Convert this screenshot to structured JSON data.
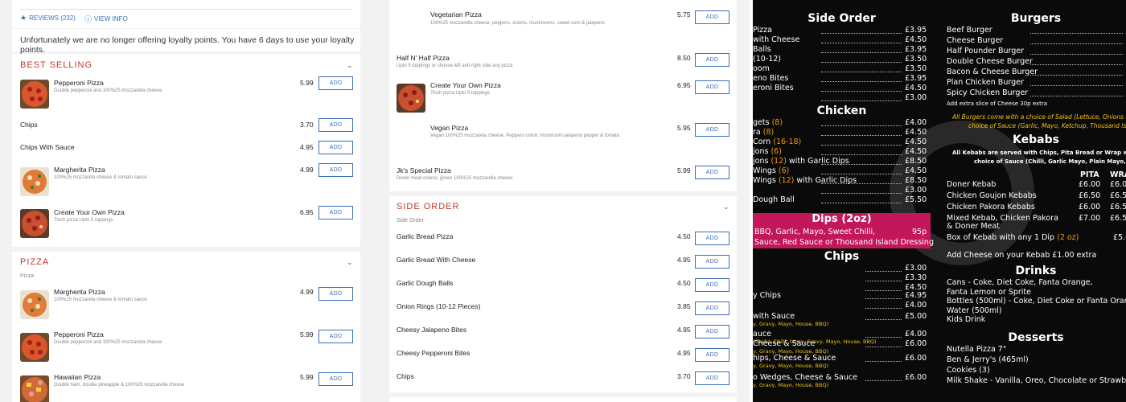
{
  "header": {
    "reviews": "REVIEWS (232)",
    "view_info": "VIEW INFO",
    "loyalty_notice": "Unfortunately we are no longer offering loyalty points. You have 6 days to use your loyalty points."
  },
  "add_label": "ADD",
  "best_selling": {
    "title": "BEST SELLING",
    "items": [
      {
        "name": "Pepperoni Pizza",
        "desc": "Double pepperoni and 100%25 mozzarella cheese",
        "price": "5.99"
      },
      {
        "name": "Chips",
        "desc": "",
        "price": "3.70"
      },
      {
        "name": "Chips With Sauce",
        "desc": "",
        "price": "4.95"
      },
      {
        "name": "Margherita Pizza",
        "desc": "100%25 mozzarela cheese & tomato sauce",
        "price": "4.99"
      },
      {
        "name": "Create Your Own Pizza",
        "desc": "7inch pizza Upto 5 toppings",
        "price": "6.95"
      }
    ]
  },
  "pizza": {
    "title": "PIZZA",
    "subtitle": "Pizza",
    "items": [
      {
        "name": "Margherita Pizza",
        "desc": "100%25 mozzarela cheese & tomato sauce",
        "price": "4.99"
      },
      {
        "name": "Pepperoni Pizza",
        "desc": "Double pepperoni and 100%25 mozzarella cheese",
        "price": "5.99"
      },
      {
        "name": "Hawaiian Pizza",
        "desc": "Double ham, double pineapple & 100%25 mozzarella cheese",
        "price": "5.99"
      }
    ]
  },
  "pizza_continued": {
    "items": [
      {
        "name": "Vegetarian Pizza",
        "desc": "100%25 mozzarella cheese, peppers, onions, mushrooms, sweet corn & jalapeno",
        "price": "5.75"
      },
      {
        "name": "Half N' Half Pizza",
        "desc": "Upto 5 toppings or choose left and right side any pizza",
        "price": "8.50"
      },
      {
        "name": "Create Your Own Pizza",
        "desc": "7inch pizza Upto 5 toppings",
        "price": "6.95"
      },
      {
        "name": "Vegan Pizza",
        "desc": "Vegan 100%25 mozzarela cheese. Peppers onion, mushroom jalapeno pepper & tomato",
        "price": "5.95"
      },
      {
        "name": "Jk's Special Pizza",
        "desc": "Doner meat onions, green 100%25 mozzarella cheese",
        "price": "5.99"
      }
    ]
  },
  "side_order": {
    "title": "SIDE ORDER",
    "subtitle": "Side Order",
    "items": [
      {
        "name": "Garlic Bread Pizza",
        "price": "4.50"
      },
      {
        "name": "Garlic Bread With Cheese",
        "price": "4.95"
      },
      {
        "name": "Garlic Dough Balls",
        "price": "4.50"
      },
      {
        "name": "Onion Rings (10-12 Pieces)",
        "price": "3.85"
      },
      {
        "name": "Cheesy Jalapeno Bites",
        "price": "4.95"
      },
      {
        "name": "Cheesy Pepperoni Bites",
        "price": "4.95"
      },
      {
        "name": "Chips",
        "price": "3.70"
      }
    ]
  },
  "menu_board": {
    "side_order_title": "Side Order",
    "side_items": [
      {
        "name": "Pizza",
        "price": "£3.95"
      },
      {
        "name": "with Cheese",
        "price": "£4.50"
      },
      {
        "name": "Balls",
        "price": "£3.95"
      },
      {
        "name": "(10-12)",
        "price": "£3.50"
      },
      {
        "name": "oom",
        "price": "£3.50"
      },
      {
        "name": "eno Bites",
        "price": "£3.95"
      },
      {
        "name": "eroni Bites",
        "price": "£4.50"
      },
      {
        "name": "",
        "price": "£3.00"
      }
    ],
    "chicken_title": "Chicken",
    "chicken_items": [
      {
        "name": "gets",
        "qty": "(8)",
        "rest": "",
        "price": "£4.00"
      },
      {
        "name": "ra",
        "qty": "(8)",
        "rest": "",
        "price": "£4.50"
      },
      {
        "name": "Corn",
        "qty": "(16-18)",
        "rest": "",
        "price": "£4.50"
      },
      {
        "name": "jons",
        "qty": "(6)",
        "rest": "",
        "price": "£4.50"
      },
      {
        "name": "jons",
        "qty": "(12)",
        "rest": "with Garlic Dips",
        "price": "£8.50"
      },
      {
        "name": "Wings",
        "qty": "(6)",
        "rest": "",
        "price": "£4.50"
      },
      {
        "name": "Wings",
        "qty": "(12)",
        "rest": "with Garlic Dips",
        "price": "£8.50"
      },
      {
        "name": "",
        "qty": "",
        "rest": "",
        "price": "£3.00"
      },
      {
        "name": "Dough Ball",
        "qty": "",
        "rest": "",
        "price": "£5.50"
      }
    ],
    "dips_title": "Dips (2oz)",
    "dips_line1": "BBQ, Garlic, Mayo, Sweet Chilli,",
    "dips_line2": "Sauce, Red Sauce or Thousand Island Dressing",
    "dips_price": "95p",
    "chips_title": "Chips",
    "chips_items": [
      {
        "name": "",
        "sub": "",
        "price": "£3.00"
      },
      {
        "name": "",
        "sub": "",
        "price": "£3.30"
      },
      {
        "name": "",
        "sub": "",
        "price": "£4.50"
      },
      {
        "name": "y Chips",
        "sub": "",
        "price": "£4.95"
      },
      {
        "name": "",
        "sub": "",
        "price": "£4.00"
      },
      {
        "name": "with Sauce",
        "sub": "y, Gravy, Mayo, House, BBQ)",
        "price": "£5.00"
      },
      {
        "name": "auce",
        "sub": "(Garlic, Chilli, Curry, Gravy, Mayo, House, BBQ)",
        "price": "£4.00"
      },
      {
        "name": "Cheese & Sauce",
        "sub": "y, Gravy, Mayo, House, BBQ)",
        "price": "£6.00"
      },
      {
        "name": "hips, Cheese & Sauce",
        "sub": "y, Gravy, Mayo, House, BBQ)",
        "price": "£6.00"
      },
      {
        "name": "o Wedges, Cheese & Sauce",
        "sub": "y, Gravy, Mayo, House, BBQ)",
        "price": "£6.00"
      }
    ],
    "burgers_title": "Burgers",
    "burger_items": [
      "Beef Burger",
      "Cheese Burger",
      "Half Pounder Burger",
      "Double Cheese Burger",
      "Bacon & Cheese Burger",
      "Plan Chicken Burger",
      "Spicy Chicken Burger"
    ],
    "burger_note": "Add extra slice of Cheese 30p extra",
    "burger_choice_1": "All Burgers come with a choice of Salad (Lettuce, Onions &",
    "burger_choice_2": "choice of Sauce (Garlic, Mayo, Ketchup, Thousand Isla",
    "kebabs_title": "Kebabs",
    "kebab_note_1": "All Kebabs are served with Chips, Pita Bread or Wrap wi",
    "kebab_note_2": "choice of Sauce (Chilli, Garlic Mayo, Plain Mayo, House &",
    "kebab_col_pita": "PITA",
    "kebab_col_wrap": "WRA",
    "kebab_items": [
      {
        "name": "Doner Kebab",
        "pita": "£6.00",
        "wrap": "£6.0"
      },
      {
        "name": "Chicken Goujon Kebabs",
        "pita": "£6.50",
        "wrap": "£6.5"
      },
      {
        "name": "Chicken Pakora Kebabs",
        "pita": "£6.00",
        "wrap": "£6.5"
      },
      {
        "name": "Mixed Kebab, Chicken Pakora",
        "pita": "£7.00",
        "wrap": "£6.5"
      }
    ],
    "kebab_doner_line": "& Doner Meat",
    "kebab_box": "Box of Kebab with any 1 Dip",
    "kebab_box_qty": "(2 oz)",
    "kebab_box_price": "£5.0",
    "kebab_cheese": "Add Cheese on your Kebab £1.00 extra",
    "drinks_title": "Drinks",
    "drinks_lines": [
      "Cans - Coke, Diet Coke, Fanta Orange,",
      "Fanta Lemon or Sprite",
      "Bottles (500ml) - Coke, Diet Coke or Fanta Orange",
      "Water (500ml)",
      "Kids Drink"
    ],
    "desserts_title": "Desserts",
    "dessert_lines": [
      "Nutella Pizza 7\"",
      "Ben & Jerry's (465ml)",
      "Cookies (3)",
      "Milk Shake - Vanilla, Oreo, Chocolate or Strawberry"
    ]
  }
}
